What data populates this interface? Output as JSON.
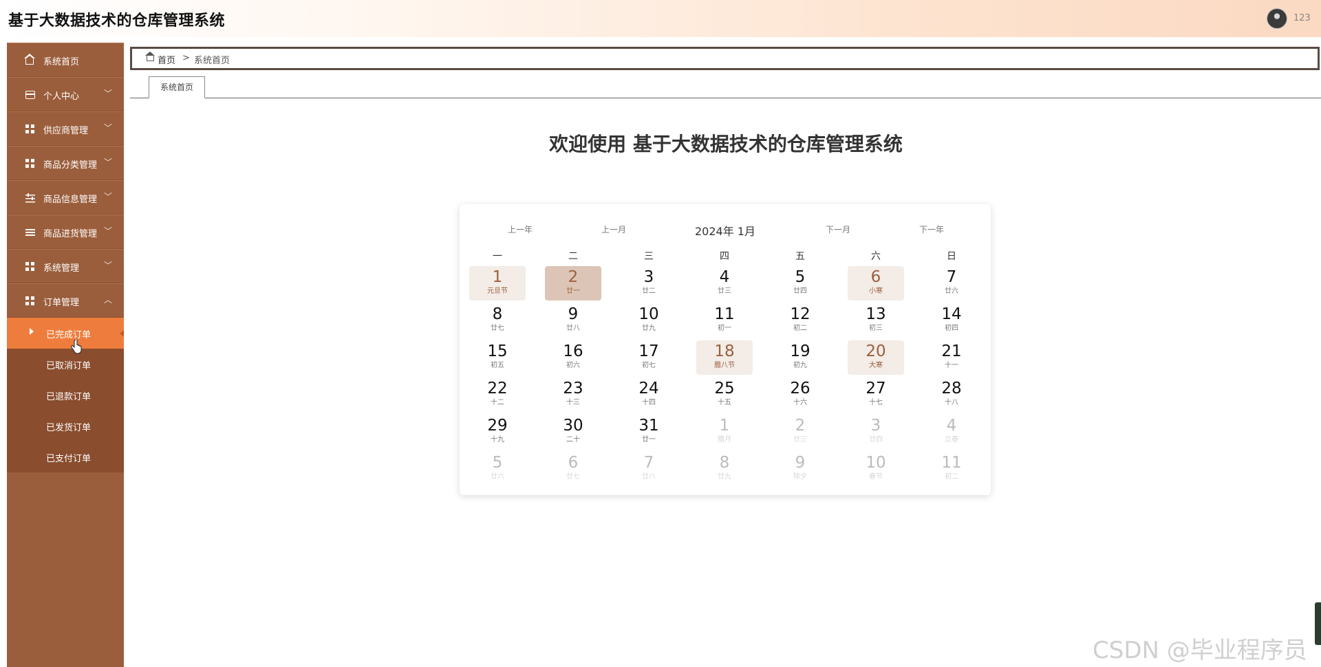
{
  "header": {
    "app_title": "基于大数据技术的仓库管理系统",
    "user_name": "123"
  },
  "sidebar": {
    "items": [
      {
        "label": "系统首页",
        "icon": "home-icon"
      },
      {
        "label": "个人中心",
        "icon": "card-icon",
        "arrow": "﹀"
      },
      {
        "label": "供应商管理",
        "icon": "grid-icon",
        "arrow": "﹀"
      },
      {
        "label": "商品分类管理",
        "icon": "grid-icon",
        "arrow": "﹀"
      },
      {
        "label": "商品信息管理",
        "icon": "sliders-icon",
        "arrow": "﹀"
      },
      {
        "label": "商品进货管理",
        "icon": "list-icon",
        "arrow": "﹀"
      },
      {
        "label": "系统管理",
        "icon": "grid-icon",
        "arrow": "﹀"
      },
      {
        "label": "订单管理",
        "icon": "grid-icon",
        "arrow": "︿"
      }
    ],
    "sub_items": [
      "已完成订单",
      "已取消订单",
      "已退款订单",
      "已发货订单",
      "已支付订单"
    ],
    "active_sub": "已完成订单"
  },
  "breadcrumb": {
    "home": "首页",
    "separator": ">",
    "current": "系统首页"
  },
  "tabs": [
    "系统首页"
  ],
  "welcome": "欢迎使用 基于大数据技术的仓库管理系统",
  "calendar": {
    "prev_year": "上一年",
    "prev_month": "上一月",
    "title": "2024年 1月",
    "next_month": "下一月",
    "next_year": "下一年",
    "weekdays": [
      "一",
      "二",
      "三",
      "四",
      "五",
      "六",
      "日"
    ],
    "days": [
      {
        "n": "1",
        "l": "元旦节",
        "s": "hl"
      },
      {
        "n": "2",
        "l": "廿一",
        "s": "sel"
      },
      {
        "n": "3",
        "l": "廿二"
      },
      {
        "n": "4",
        "l": "廿三"
      },
      {
        "n": "5",
        "l": "廿四"
      },
      {
        "n": "6",
        "l": "小寒",
        "s": "hl"
      },
      {
        "n": "7",
        "l": "廿六"
      },
      {
        "n": "8",
        "l": "廿七"
      },
      {
        "n": "9",
        "l": "廿八"
      },
      {
        "n": "10",
        "l": "廿九"
      },
      {
        "n": "11",
        "l": "初一"
      },
      {
        "n": "12",
        "l": "初二"
      },
      {
        "n": "13",
        "l": "初三"
      },
      {
        "n": "14",
        "l": "初四"
      },
      {
        "n": "15",
        "l": "初五"
      },
      {
        "n": "16",
        "l": "初六"
      },
      {
        "n": "17",
        "l": "初七"
      },
      {
        "n": "18",
        "l": "腊八节",
        "s": "hl"
      },
      {
        "n": "19",
        "l": "初九"
      },
      {
        "n": "20",
        "l": "大寒",
        "s": "hl"
      },
      {
        "n": "21",
        "l": "十一"
      },
      {
        "n": "22",
        "l": "十二"
      },
      {
        "n": "23",
        "l": "十三"
      },
      {
        "n": "24",
        "l": "十四"
      },
      {
        "n": "25",
        "l": "十五"
      },
      {
        "n": "26",
        "l": "十六"
      },
      {
        "n": "27",
        "l": "十七"
      },
      {
        "n": "28",
        "l": "十八"
      },
      {
        "n": "29",
        "l": "十九"
      },
      {
        "n": "30",
        "l": "二十"
      },
      {
        "n": "31",
        "l": "廿一"
      },
      {
        "n": "1",
        "l": "腊月",
        "s": "other"
      },
      {
        "n": "2",
        "l": "廿三",
        "s": "other"
      },
      {
        "n": "3",
        "l": "廿四",
        "s": "other"
      },
      {
        "n": "4",
        "l": "立春",
        "s": "other"
      },
      {
        "n": "5",
        "l": "廿六",
        "s": "other"
      },
      {
        "n": "6",
        "l": "廿七",
        "s": "other"
      },
      {
        "n": "7",
        "l": "廿八",
        "s": "other"
      },
      {
        "n": "8",
        "l": "廿九",
        "s": "other"
      },
      {
        "n": "9",
        "l": "除夕",
        "s": "other"
      },
      {
        "n": "10",
        "l": "春节",
        "s": "other"
      },
      {
        "n": "11",
        "l": "初二",
        "s": "other"
      }
    ]
  },
  "watermark": "CSDN @毕业程序员",
  "colors": {
    "sidebar": "#9b5e3c",
    "active": "#ee7d3d",
    "highlight": "#f3ece7",
    "selected": "#dcc5b6"
  }
}
